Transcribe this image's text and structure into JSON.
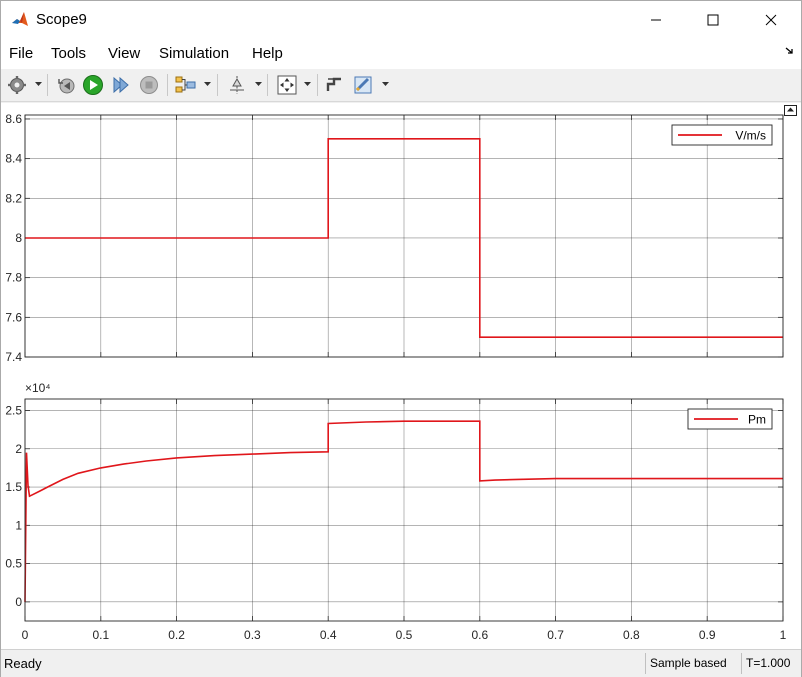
{
  "window": {
    "title": "Scope9",
    "controls": [
      "minimize",
      "maximize",
      "close"
    ]
  },
  "menu": {
    "items": [
      "File",
      "Tools",
      "View",
      "Simulation",
      "Help"
    ]
  },
  "toolbar": {
    "icons": [
      "gear-icon",
      "step-back-icon",
      "run-icon",
      "step-forward-icon",
      "stop-icon",
      "highlight-block-icon",
      "cursor-measure-icon",
      "zoom-fit-icon",
      "signal-select-icon",
      "style-icon"
    ]
  },
  "colors": {
    "signal": "#e0161b",
    "grid": "#262626",
    "run_green": "#2aa52a"
  },
  "status": {
    "ready": "Ready",
    "sample_mode": "Sample based",
    "time": "T=1.000"
  },
  "chart_data": [
    {
      "type": "line",
      "legend": "V/m/s",
      "legend_position": "top-right",
      "grid": true,
      "xlim": [
        0,
        1
      ],
      "ylim": [
        7.4,
        8.62
      ],
      "x_ticks": [
        0,
        0.1,
        0.2,
        0.3,
        0.4,
        0.5,
        0.6,
        0.7,
        0.8,
        0.9,
        1
      ],
      "y_ticks": [
        "7.4",
        "7.6",
        "7.8",
        "8",
        "8.2",
        "8.4",
        "8.6"
      ],
      "series": [
        {
          "name": "V/m/s",
          "x": [
            0,
            0.4,
            0.4,
            0.6,
            0.6,
            1.0
          ],
          "y": [
            8.0,
            8.0,
            8.5,
            8.5,
            7.5,
            7.5
          ]
        }
      ]
    },
    {
      "type": "line",
      "legend": "Pm",
      "legend_position": "top-right",
      "grid": true,
      "y_exponent": "×10⁴",
      "xlim": [
        0,
        1
      ],
      "ylim": [
        -0.25,
        2.65
      ],
      "x_ticks": [
        "0",
        "0.1",
        "0.2",
        "0.3",
        "0.4",
        "0.5",
        "0.6",
        "0.7",
        "0.8",
        "0.9",
        "1"
      ],
      "y_ticks": [
        "0",
        "0.5",
        "1",
        "1.5",
        "2",
        "2.5"
      ],
      "series": [
        {
          "name": "Pm",
          "x": [
            0,
            0.002,
            0.004,
            0.006,
            0.01,
            0.02,
            0.03,
            0.05,
            0.07,
            0.1,
            0.13,
            0.16,
            0.2,
            0.25,
            0.3,
            0.35,
            0.4,
            0.4,
            0.45,
            0.5,
            0.55,
            0.6,
            0.6,
            0.62,
            0.65,
            0.7,
            0.8,
            0.9,
            1.0
          ],
          "y": [
            0.0,
            1.95,
            1.52,
            1.38,
            1.4,
            1.45,
            1.5,
            1.6,
            1.68,
            1.75,
            1.8,
            1.84,
            1.88,
            1.91,
            1.93,
            1.95,
            1.96,
            2.33,
            2.35,
            2.36,
            2.36,
            2.36,
            1.58,
            1.59,
            1.6,
            1.61,
            1.61,
            1.61,
            1.61
          ]
        }
      ]
    }
  ]
}
